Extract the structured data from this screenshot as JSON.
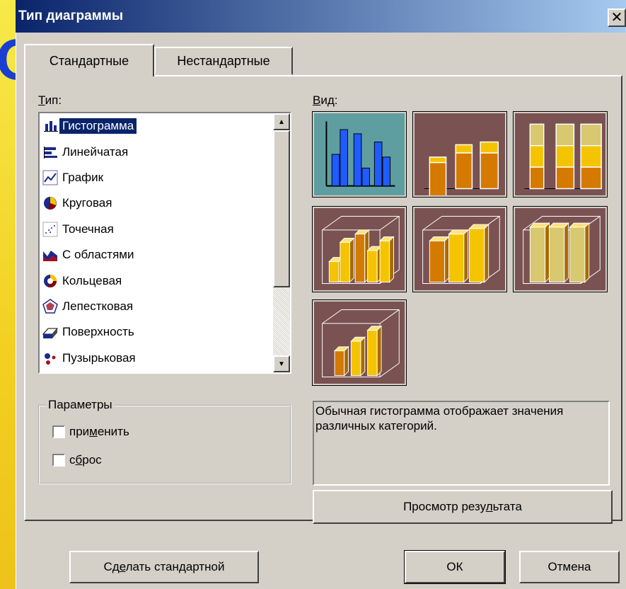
{
  "background": {
    "glyph": "О"
  },
  "window": {
    "title": "Тип диаграммы",
    "close_icon": "✕"
  },
  "tabs": [
    {
      "label": "Стандартные",
      "active": true
    },
    {
      "label": "Нестандартные",
      "active": false
    }
  ],
  "type_list": {
    "label": "Тип:",
    "items": [
      {
        "label": "Гистограмма",
        "icon": "column-chart-icon",
        "selected": true
      },
      {
        "label": "Линейчатая",
        "icon": "bar-chart-icon"
      },
      {
        "label": "График",
        "icon": "line-chart-icon"
      },
      {
        "label": "Круговая",
        "icon": "pie-chart-icon"
      },
      {
        "label": "Точечная",
        "icon": "scatter-chart-icon"
      },
      {
        "label": "С областями",
        "icon": "area-chart-icon"
      },
      {
        "label": "Кольцевая",
        "icon": "doughnut-chart-icon"
      },
      {
        "label": "Лепестковая",
        "icon": "radar-chart-icon"
      },
      {
        "label": "Поверхность",
        "icon": "surface-chart-icon"
      },
      {
        "label": "Пузырьковая",
        "icon": "bubble-chart-icon"
      }
    ]
  },
  "subtype": {
    "label": "Вид:",
    "thumbnails": [
      {
        "name": "clustered-column",
        "selected": true
      },
      {
        "name": "stacked-column"
      },
      {
        "name": "percent-stacked-column"
      },
      {
        "name": "clustered-column-3d-effect"
      },
      {
        "name": "stacked-column-3d-effect"
      },
      {
        "name": "percent-stacked-column-3d-effect"
      },
      {
        "name": "column-3d"
      }
    ]
  },
  "params": {
    "legend": "Параметры",
    "checkboxes": [
      {
        "label_pre": "при",
        "label_u": "м",
        "label_post": "енить",
        "checked": false
      },
      {
        "label_pre": "с",
        "label_u": "б",
        "label_post": "рос",
        "checked": false
      }
    ]
  },
  "description": "Обычная гистограмма отображает значения различных категорий.",
  "preview_button": {
    "pre": "Просмотр резу",
    "u": "л",
    "post": "ьтата"
  },
  "footer": {
    "default_button": {
      "pre": "Сд",
      "u": "е",
      "post": "лать стандартной"
    },
    "ok": "ОК",
    "cancel": "Отмена"
  },
  "colors": {
    "title_start": "#0a246a",
    "title_end": "#a6caf0",
    "thumb_bg": "#7a5252",
    "thumb_selected_bg": "#5f9ea0",
    "bar_gold": "#f5c400",
    "bar_orange": "#d47a00",
    "bar_light": "#d8c870",
    "bar_blue": "#1e5cff"
  }
}
